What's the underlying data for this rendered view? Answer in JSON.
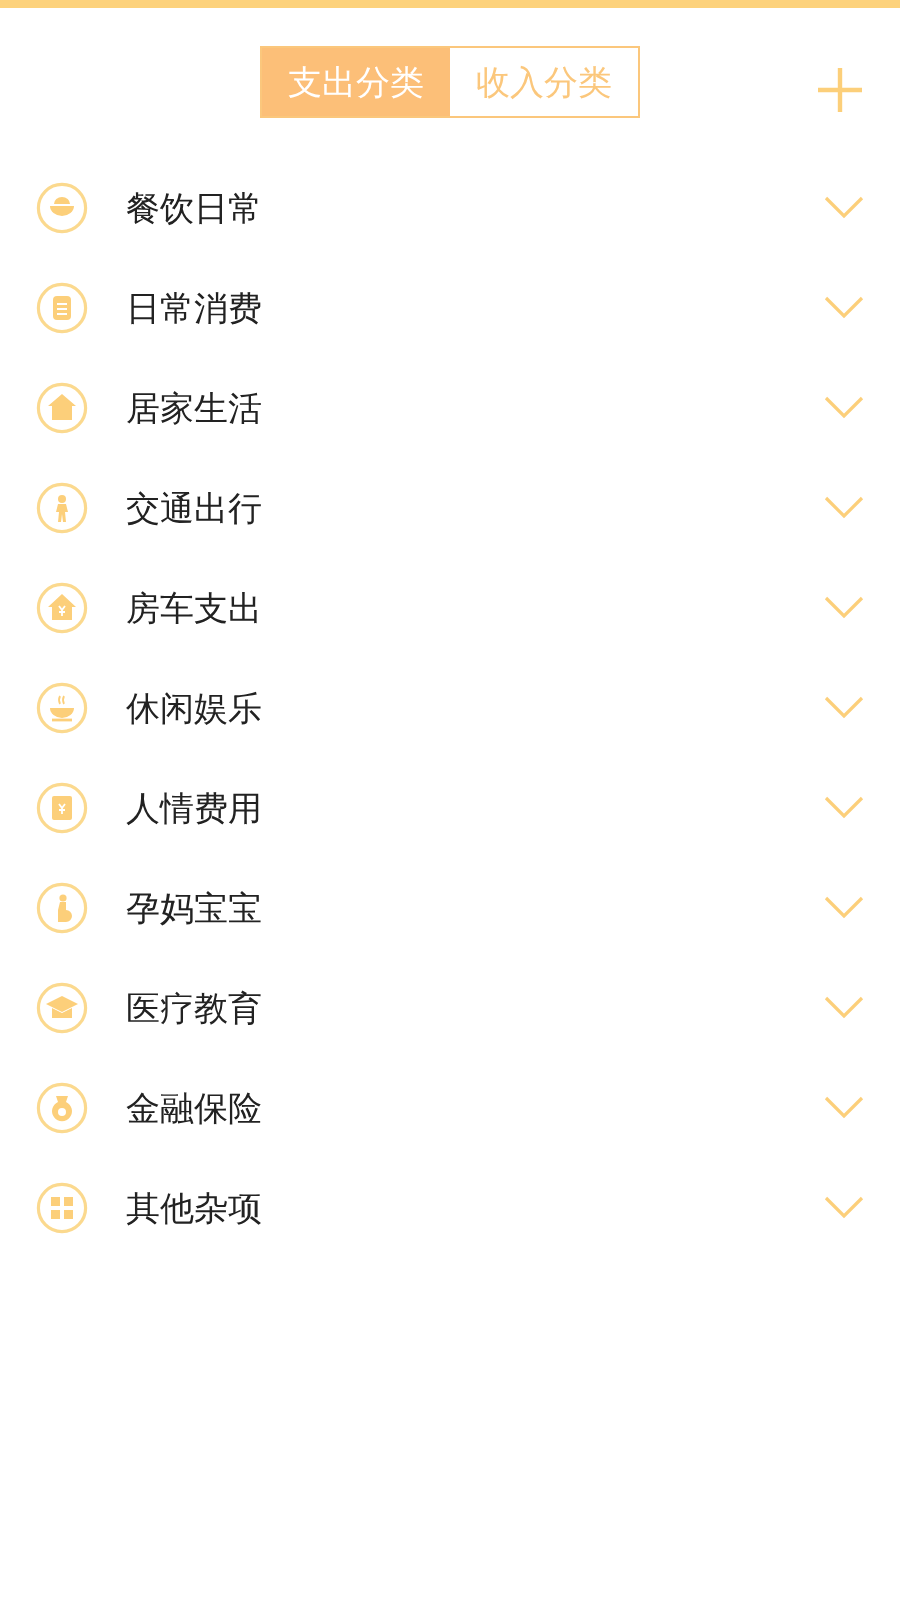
{
  "tabs": [
    {
      "label": "支出分类",
      "selected": true
    },
    {
      "label": "收入分类",
      "selected": false
    }
  ],
  "categories": [
    {
      "name": "餐饮日常"
    },
    {
      "name": "日常消费"
    },
    {
      "name": "居家生活"
    },
    {
      "name": "交通出行"
    },
    {
      "name": "房车支出"
    },
    {
      "name": "休闲娱乐"
    },
    {
      "name": "人情费用"
    },
    {
      "name": "孕妈宝宝"
    },
    {
      "name": "医疗教育"
    },
    {
      "name": "金融保险"
    },
    {
      "name": "其他杂项"
    }
  ]
}
